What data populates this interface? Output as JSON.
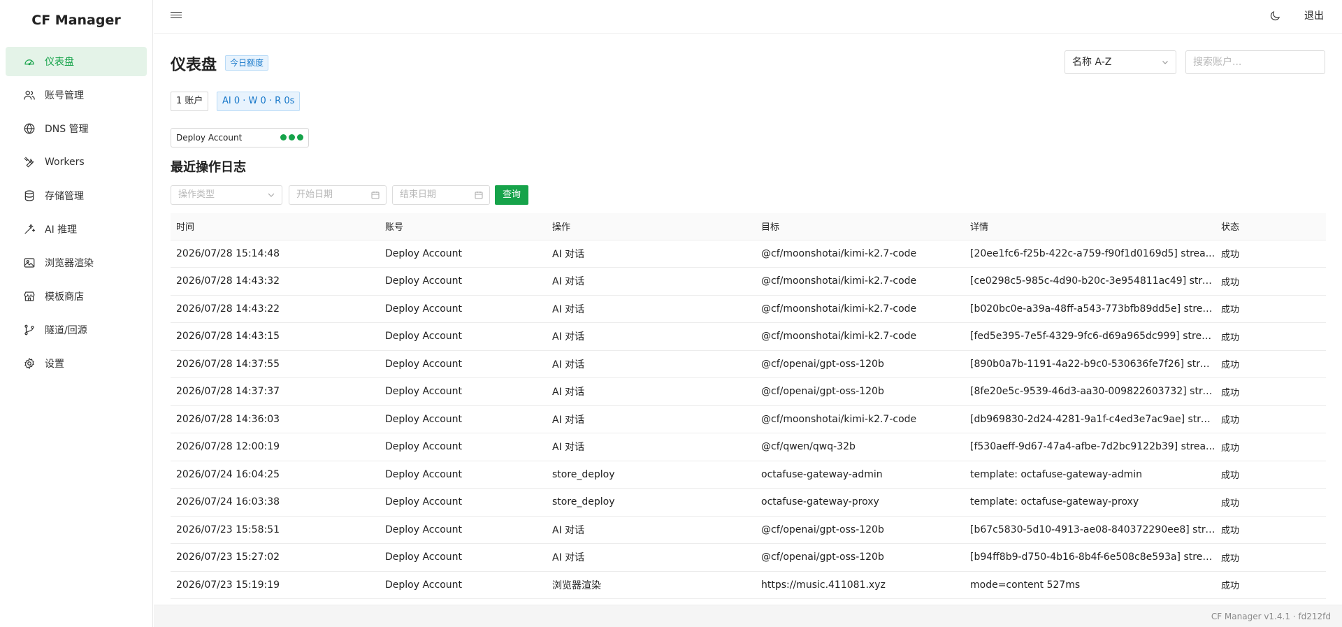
{
  "app": {
    "title": "CF Manager"
  },
  "sidebar": {
    "items": [
      {
        "label": "仪表盘",
        "icon": "dashboard-icon",
        "active": true
      },
      {
        "label": "账号管理",
        "icon": "users-icon",
        "active": false
      },
      {
        "label": "DNS 管理",
        "icon": "globe-icon",
        "active": false
      },
      {
        "label": "Workers",
        "icon": "tools-icon",
        "active": false
      },
      {
        "label": "存储管理",
        "icon": "database-icon",
        "active": false
      },
      {
        "label": "AI 推理",
        "icon": "sparkles-icon",
        "active": false
      },
      {
        "label": "浏览器渲染",
        "icon": "image-icon",
        "active": false
      },
      {
        "label": "模板商店",
        "icon": "store-icon",
        "active": false
      },
      {
        "label": "隧道/回源",
        "icon": "branch-icon",
        "active": false
      },
      {
        "label": "设置",
        "icon": "gear-icon",
        "active": false
      }
    ]
  },
  "topbar": {
    "logout_label": "退出"
  },
  "dashboard": {
    "title": "仪表盘",
    "quota_badge": "今日额度",
    "sort": {
      "value": "名称 A-Z"
    },
    "search": {
      "placeholder": "搜索账户..."
    },
    "stats": {
      "accounts": "1 账户",
      "ai": "AI 0 · W 0 · R 0s"
    },
    "account_card": {
      "name": "Deploy Account"
    }
  },
  "logs": {
    "title": "最近操作日志",
    "filters": {
      "type_placeholder": "操作类型",
      "start_placeholder": "开始日期",
      "end_placeholder": "结束日期",
      "query_label": "查询"
    },
    "columns": [
      "时间",
      "账号",
      "操作",
      "目标",
      "详情",
      "状态"
    ],
    "rows": [
      [
        "2026/07/28 15:14:48",
        "Deploy Account",
        "AI 对话",
        "@cf/moonshotai/kimi-k2.7-code",
        "[20ee1fc6-f25b-422c-a759-f90f1d0169d5] strea...",
        "成功"
      ],
      [
        "2026/07/28 14:43:32",
        "Deploy Account",
        "AI 对话",
        "@cf/moonshotai/kimi-k2.7-code",
        "[ce0298c5-985c-4d90-b20c-3e954811ac49] strea...",
        "成功"
      ],
      [
        "2026/07/28 14:43:22",
        "Deploy Account",
        "AI 对话",
        "@cf/moonshotai/kimi-k2.7-code",
        "[b020bc0e-a39a-48ff-a543-773bfb89dd5e] strea...",
        "成功"
      ],
      [
        "2026/07/28 14:43:15",
        "Deploy Account",
        "AI 对话",
        "@cf/moonshotai/kimi-k2.7-code",
        "[fed5e395-7e5f-4329-9fc6-d69a965dc999] strea...",
        "成功"
      ],
      [
        "2026/07/28 14:37:55",
        "Deploy Account",
        "AI 对话",
        "@cf/openai/gpt-oss-120b",
        "[890b0a7b-1191-4a22-b9c0-530636fe7f26] strea...",
        "成功"
      ],
      [
        "2026/07/28 14:37:37",
        "Deploy Account",
        "AI 对话",
        "@cf/openai/gpt-oss-120b",
        "[8fe20e5c-9539-46d3-aa30-009822603732] strea...",
        "成功"
      ],
      [
        "2026/07/28 14:36:03",
        "Deploy Account",
        "AI 对话",
        "@cf/moonshotai/kimi-k2.7-code",
        "[db969830-2d24-4281-9a1f-c4ed3e7ac9ae] strea...",
        "成功"
      ],
      [
        "2026/07/28 12:00:19",
        "Deploy Account",
        "AI 对话",
        "@cf/qwen/qwq-32b",
        "[f530aeff-9d67-47a4-afbe-7d2bc9122b39] strea...",
        "成功"
      ],
      [
        "2026/07/24 16:04:25",
        "Deploy Account",
        "store_deploy",
        "octafuse-gateway-admin",
        "template: octafuse-gateway-admin",
        "成功"
      ],
      [
        "2026/07/24 16:03:38",
        "Deploy Account",
        "store_deploy",
        "octafuse-gateway-proxy",
        "template: octafuse-gateway-proxy",
        "成功"
      ],
      [
        "2026/07/23 15:58:51",
        "Deploy Account",
        "AI 对话",
        "@cf/openai/gpt-oss-120b",
        "[b67c5830-5d10-4913-ae08-840372290ee8] stre...",
        "成功"
      ],
      [
        "2026/07/23 15:27:02",
        "Deploy Account",
        "AI 对话",
        "@cf/openai/gpt-oss-120b",
        "[b94ff8b9-d750-4b16-8b4f-6e508c8e593a] strea...",
        "成功"
      ],
      [
        "2026/07/23 15:19:19",
        "Deploy Account",
        "浏览器渲染",
        "https://music.411081.xyz",
        "mode=content 527ms",
        "成功"
      ]
    ]
  },
  "footer": {
    "version": "CF Manager v1.4.1 · fd212fd"
  },
  "colors": {
    "accent": "#16a34a",
    "info": "#1677c9"
  }
}
